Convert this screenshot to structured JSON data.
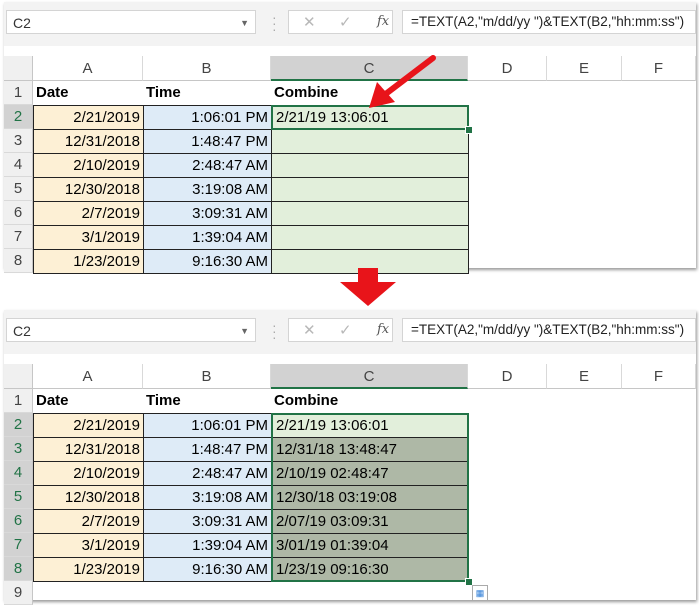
{
  "top": {
    "name_box": "C2",
    "formula": "=TEXT(A2,\"m/dd/yy \")&TEXT(B2,\"hh:mm:ss\")",
    "columns": [
      "A",
      "B",
      "C",
      "D",
      "E",
      "F"
    ],
    "rows": [
      "1",
      "2",
      "3",
      "4",
      "5",
      "6",
      "7",
      "8"
    ],
    "headers": [
      "Date",
      "Time",
      "Combine"
    ],
    "data": [
      [
        "2/21/2019",
        "1:06:01 PM",
        "2/21/19 13:06:01"
      ],
      [
        "12/31/2018",
        "1:48:47 PM",
        ""
      ],
      [
        "2/10/2019",
        "2:48:47 AM",
        ""
      ],
      [
        "12/30/2018",
        "3:19:08 AM",
        ""
      ],
      [
        "2/7/2019",
        "3:09:31 AM",
        ""
      ],
      [
        "3/1/2019",
        "1:39:04 AM",
        ""
      ],
      [
        "1/23/2019",
        "9:16:30 AM",
        ""
      ]
    ]
  },
  "bottom": {
    "name_box": "C2",
    "formula": "=TEXT(A2,\"m/dd/yy \")&TEXT(B2,\"hh:mm:ss\")",
    "columns": [
      "A",
      "B",
      "C",
      "D",
      "E",
      "F"
    ],
    "rows": [
      "1",
      "2",
      "3",
      "4",
      "5",
      "6",
      "7",
      "8",
      "9"
    ],
    "headers": [
      "Date",
      "Time",
      "Combine"
    ],
    "data": [
      [
        "2/21/2019",
        "1:06:01 PM",
        "2/21/19 13:06:01"
      ],
      [
        "12/31/2018",
        "1:48:47 PM",
        "12/31/18 13:48:47"
      ],
      [
        "2/10/2019",
        "2:48:47 AM",
        "2/10/19 02:48:47"
      ],
      [
        "12/30/2018",
        "3:19:08 AM",
        "12/30/18 03:19:08"
      ],
      [
        "2/7/2019",
        "3:09:31 AM",
        "2/07/19 03:09:31"
      ],
      [
        "3/1/2019",
        "1:39:04 AM",
        "3/01/19 01:39:04"
      ],
      [
        "1/23/2019",
        "9:16:30 AM",
        "1/23/19 09:16:30"
      ]
    ]
  },
  "colors": {
    "accent": "#217346",
    "arrow": "#e8141a"
  }
}
